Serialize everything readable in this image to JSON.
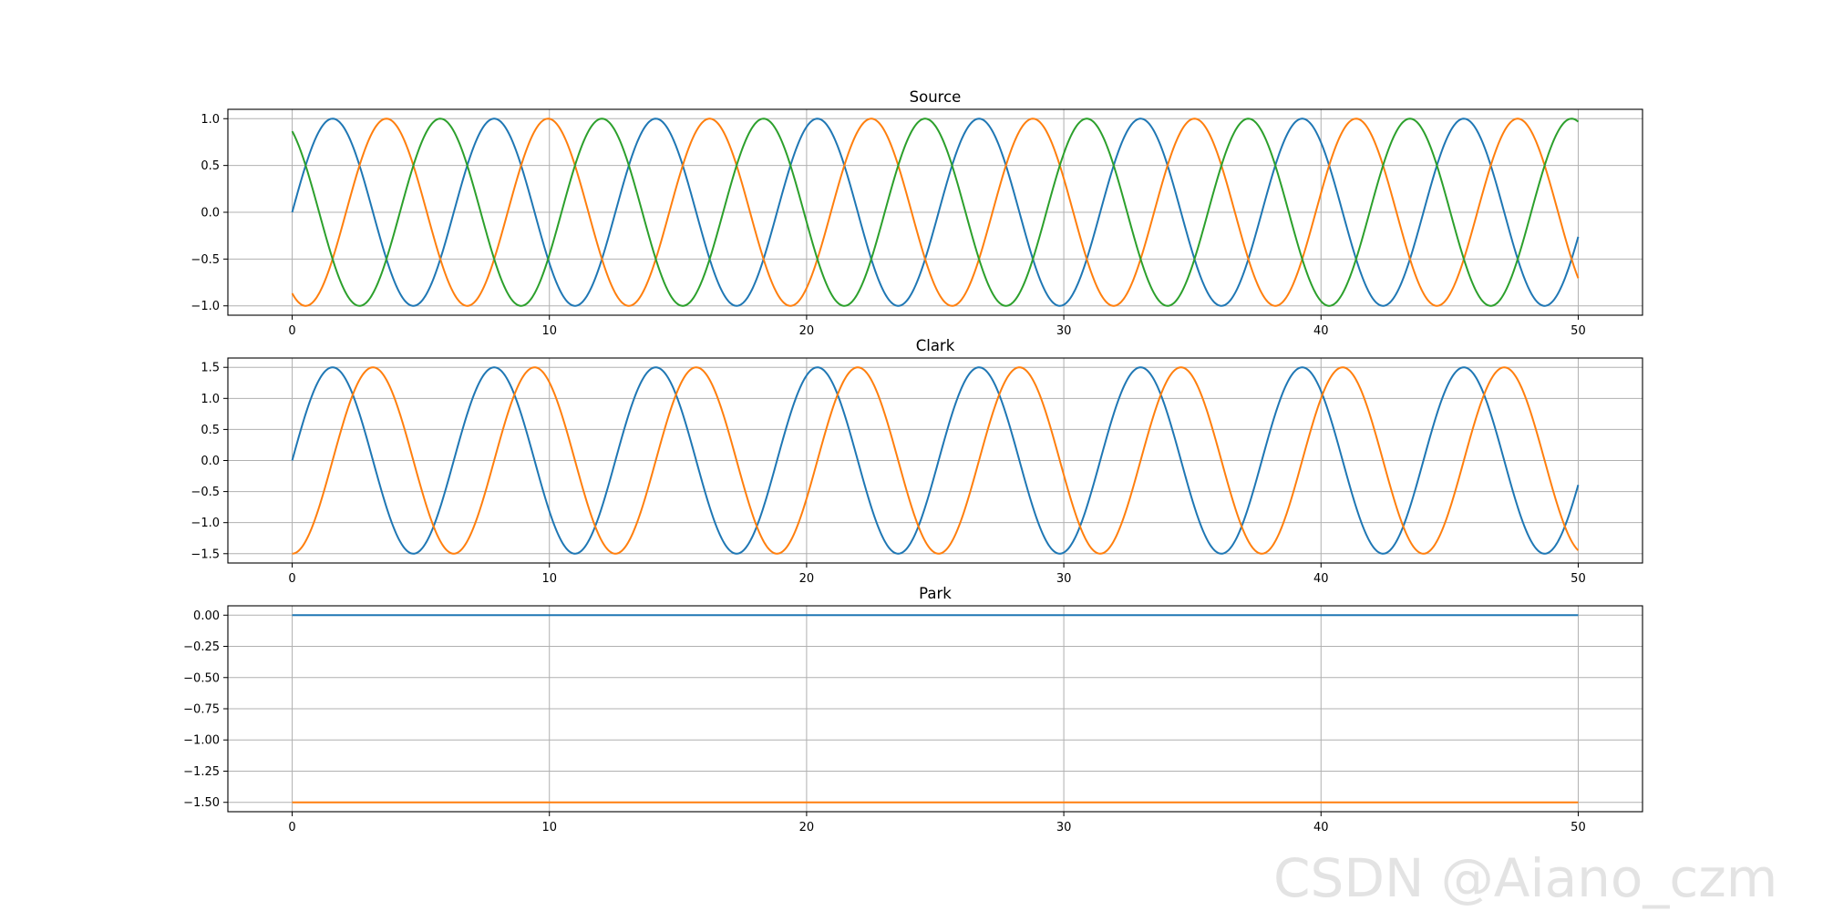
{
  "watermark": "CSDN @Aiano_czm",
  "chart_data": [
    {
      "type": "line",
      "title": "Source",
      "xlim": [
        -2.5,
        52.5
      ],
      "ylim": [
        -1.1,
        1.1
      ],
      "xticks": [
        0,
        10,
        20,
        30,
        40,
        50
      ],
      "yticks": [
        -1.0,
        -0.5,
        0.0,
        0.5,
        1.0
      ],
      "ytick_labels": [
        "−1.0",
        "−0.5",
        "0.0",
        "0.5",
        "1.0"
      ],
      "grid": true,
      "x": [
        0,
        50
      ],
      "series": [
        {
          "color": "#1f77b4",
          "formula": "1.0*sin(x)",
          "start": 0.0,
          "end": -0.26
        },
        {
          "color": "#ff7f0e",
          "formula": "1.0*sin(x - 2.094)",
          "start": -0.87,
          "end": -0.71
        },
        {
          "color": "#2ca02c",
          "formula": "1.0*sin(x + 2.094)",
          "start": 0.87,
          "end": 0.97
        }
      ]
    },
    {
      "type": "line",
      "title": "Clark",
      "xlim": [
        -2.5,
        52.5
      ],
      "ylim": [
        -1.65,
        1.65
      ],
      "xticks": [
        0,
        10,
        20,
        30,
        40,
        50
      ],
      "yticks": [
        -1.5,
        -1.0,
        -0.5,
        0.0,
        0.5,
        1.0,
        1.5
      ],
      "ytick_labels": [
        "−1.5",
        "−1.0",
        "−0.5",
        "0.0",
        "0.5",
        "1.0",
        "1.5"
      ],
      "grid": true,
      "x": [
        0,
        50
      ],
      "series": [
        {
          "color": "#1f77b4",
          "formula": "1.5*sin(x)",
          "start": 0.0,
          "end": -0.39
        },
        {
          "color": "#ff7f0e",
          "formula": "-1.5*cos(x)",
          "start": -1.5,
          "end": -1.45
        }
      ]
    },
    {
      "type": "line",
      "title": "Park",
      "xlim": [
        -2.5,
        52.5
      ],
      "ylim": [
        -1.575,
        0.075
      ],
      "xticks": [
        0,
        10,
        20,
        30,
        40,
        50
      ],
      "yticks": [
        -1.5,
        -1.25,
        -1.0,
        -0.75,
        -0.5,
        -0.25,
        0.0
      ],
      "ytick_labels": [
        "−1.50",
        "−1.25",
        "−1.00",
        "−0.75",
        "−0.50",
        "−0.25",
        "0.00"
      ],
      "grid": true,
      "x": [
        0,
        50
      ],
      "series": [
        {
          "color": "#1f77b4",
          "formula": "0",
          "values": [
            0.0,
            0.0
          ]
        },
        {
          "color": "#ff7f0e",
          "formula": "-1.5",
          "values": [
            -1.5,
            -1.5
          ]
        }
      ]
    }
  ]
}
